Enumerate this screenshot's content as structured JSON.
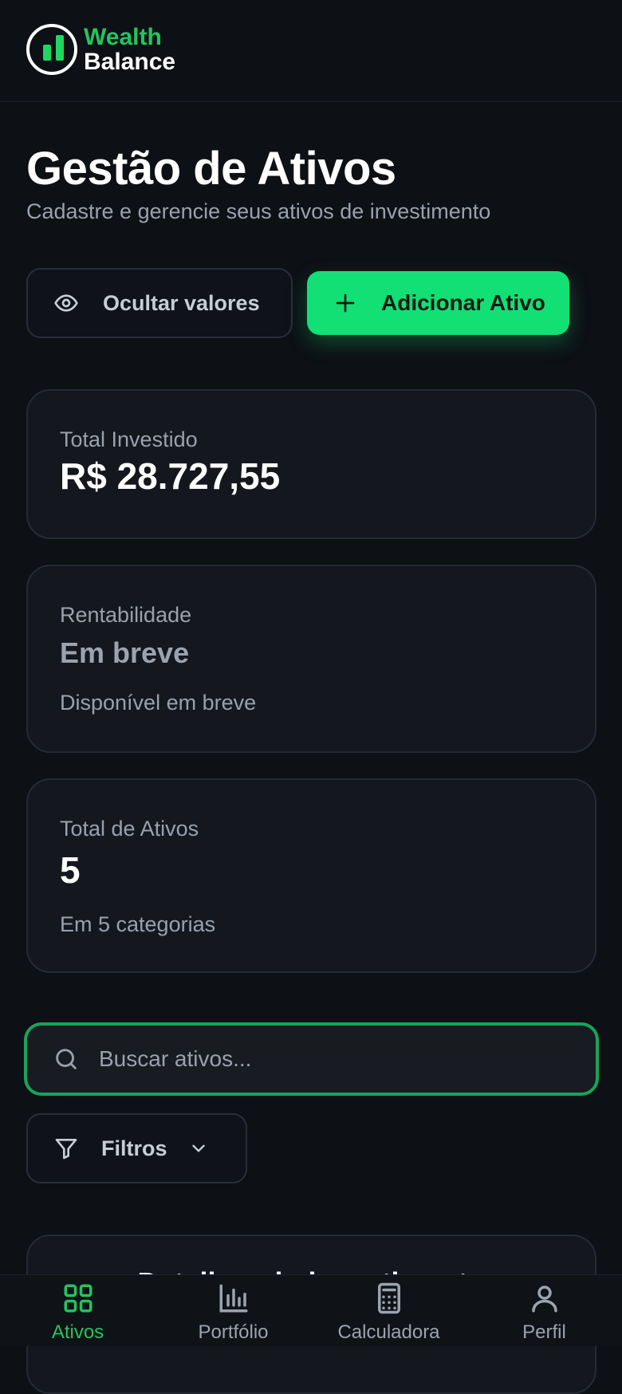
{
  "brand": {
    "line1": "Wealth",
    "line2": "Balance",
    "accent_color": "#22c55e"
  },
  "page": {
    "title": "Gestão de Ativos",
    "subtitle": "Cadastre e gerencie seus ativos de investimento"
  },
  "actions": {
    "hide_values_label": "Ocultar valores",
    "hide_values_icon": "eye-icon",
    "add_asset_label": "Adicionar Ativo",
    "add_asset_icon": "plus-icon",
    "add_asset_color": "#12e075"
  },
  "stats": {
    "invested": {
      "label": "Total Investido",
      "value": "R$ 28.727,55"
    },
    "return": {
      "label": "Rentabilidade",
      "value": "Em breve",
      "note": "Disponível em breve"
    },
    "count": {
      "label": "Total de Ativos",
      "value": "5",
      "note": "Em 5 categorias"
    }
  },
  "search": {
    "placeholder": "Buscar ativos...",
    "value": "",
    "icon": "search-icon"
  },
  "filters": {
    "label": "Filtros",
    "icon": "filter-icon"
  },
  "details": {
    "title": "Detalhes do investimento"
  },
  "nav": [
    {
      "label": "Ativos",
      "icon": "grid-icon",
      "active": true
    },
    {
      "label": "Portfólio",
      "icon": "bar-chart-icon",
      "active": false
    },
    {
      "label": "Calculadora",
      "icon": "calculator-icon",
      "active": false
    },
    {
      "label": "Perfil",
      "icon": "user-icon",
      "active": false
    }
  ]
}
